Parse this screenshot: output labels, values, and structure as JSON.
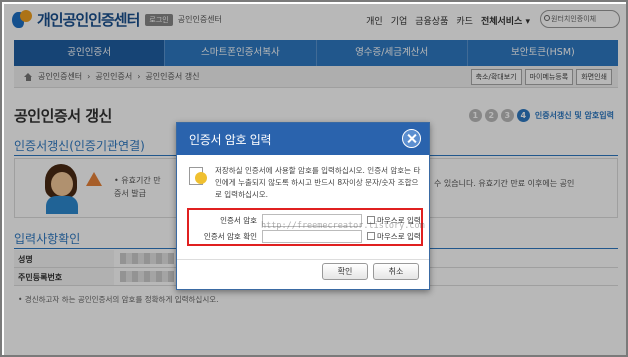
{
  "header": {
    "logo_text": "개인공인인증센터",
    "login_badge": "로그인",
    "sub_title": "공인인증센터",
    "nav": [
      "개인",
      "기업",
      "금융상품",
      "카드"
    ],
    "all_services": "전체서비스 ▾",
    "search_placeholder": "원터치인증이체"
  },
  "main_nav": {
    "items": [
      "공인인증서",
      "스마트폰인증서복사",
      "영수증/세금계산서",
      "보안토큰(HSM)"
    ]
  },
  "breadcrumb": {
    "items": [
      "공인인증센터",
      "공인인증서",
      "공인인증서 갱신"
    ],
    "buttons": [
      "축소/확대보기",
      "마이메뉴등록",
      "화면인쇄"
    ]
  },
  "page": {
    "title": "공인인증서 갱신",
    "steps": [
      "1",
      "2",
      "3",
      "4"
    ],
    "current_step_label": "인증서갱신 및 암호입력",
    "section1_title": "인증서갱신(인증기관연결)",
    "info_line1": "• 유효기간 만",
    "info_line2": "증서 발급",
    "info_right": "수 있습니다. 유효기간 만료 이후에는 공인",
    "section2_title": "입력사항확인",
    "fields": [
      {
        "label": "성명"
      },
      {
        "label": "주민등록번호"
      }
    ],
    "footnote": "• 경신하고자 하는 공인인증서의 암호를 정확하게 입력하십시오."
  },
  "dialog": {
    "title": "인증서 암호 입력",
    "message": "저장하실 인증서에 사용할 암호를 입력하십시오. 인증서 암호는 타인에게 누출되지 않도록 하시고 반드시 8자이상 문자/숫자 조합으로 입력하십시오.",
    "password_label": "인증서 암호",
    "confirm_label": "인증서 암호 확인",
    "mouse_input_label": "마우스로 입력",
    "watermark": "http://freemecreator.tistory.com",
    "ok_label": "확인",
    "cancel_label": "취소"
  },
  "colors": {
    "primary": "#2f79c2",
    "dialog_header": "#2a63ad",
    "highlight": "#e02020"
  }
}
